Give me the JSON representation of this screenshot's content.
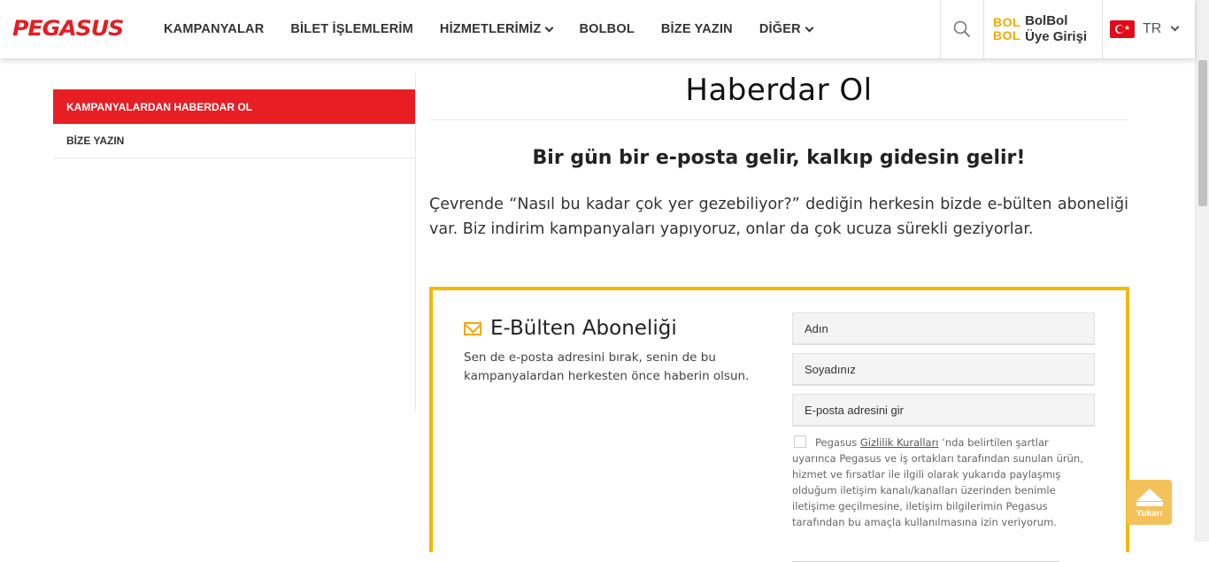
{
  "header": {
    "logo_text": "PEGASUS",
    "nav": [
      {
        "label": "KAMPANYALAR",
        "dropdown": false
      },
      {
        "label": "BİLET İŞLEMLERİM",
        "dropdown": false
      },
      {
        "label": "HİZMETLERİMİZ",
        "dropdown": true
      },
      {
        "label": "BOLBOL",
        "dropdown": false
      },
      {
        "label": "BİZE YAZIN",
        "dropdown": false
      },
      {
        "label": "DİĞER",
        "dropdown": true
      }
    ],
    "bolbol_logo": "BOL BOL",
    "bolbol_logo_line1": "BOL",
    "bolbol_logo_line2": "BOL",
    "bolbol_line1": "BolBol",
    "bolbol_line2": "Üye Girişi",
    "language": "TR"
  },
  "sidebar": {
    "items": [
      {
        "label": "KAMPANYALARDAN HABERDAR OL",
        "active": true
      },
      {
        "label": "BİZE YAZIN",
        "active": false
      }
    ]
  },
  "main": {
    "title": "Haberdar Ol",
    "subtitle": "Bir gün bir e-posta gelir, kalkıp gidesin gelir!",
    "intro": "Çevrende “Nasıl bu kadar çok yer gezebiliyor?” dediğin herkesin bizde e-bülten aboneliği var. Biz indirim kampanyaları yapıyoruz, onlar da çok ucuza sürekli geziyorlar."
  },
  "newsletter": {
    "title": "E-Bülten Aboneliği",
    "description": "Sen de e-posta adresini bırak, senin de bu kampanyalardan herkesten önce haberin olsun.",
    "fields": {
      "first_name": "Adın",
      "last_name": "Soyadınız",
      "email": "E-posta adresini gir"
    },
    "consent": {
      "prefix": "Pegasus ",
      "link": "Gizlilik Kuralları",
      "suffix": " ’nda belirtilen şartlar uyarınca Pegasus ve iş ortakları tarafından sunulan ürün, hizmet ve fırsatlar ile ilgili olarak yukarıda paylaşmış olduğum iletişim kanalı/kanalları üzerinden benimle iletişime geçilmesine, iletişim bilgilerimin Pegasus tarafından bu amaçla kullanılmasına izin veriyorum.",
      "checked": false
    }
  },
  "back_to_top": {
    "label": "Yukarı"
  },
  "colors": {
    "brand_red": "#e81e25",
    "accent_yellow": "#f5b800",
    "to_top": "#f5c15a"
  }
}
